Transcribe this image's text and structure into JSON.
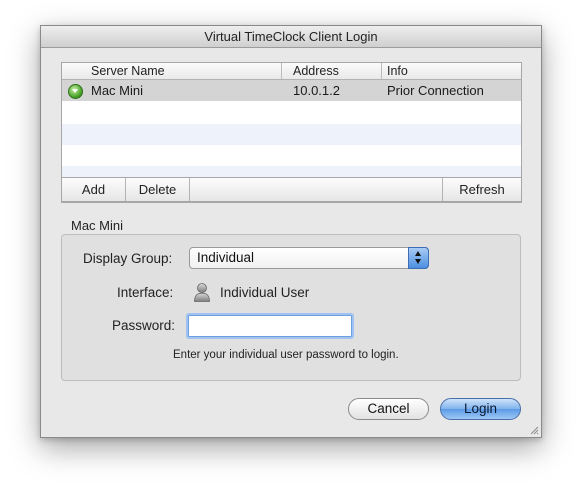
{
  "window": {
    "title": "Virtual TimeClock Client Login"
  },
  "server_table": {
    "columns": [
      "Server Name",
      "Address",
      "Info"
    ],
    "rows": [
      {
        "name": "Mac Mini",
        "address": "10.0.1.2",
        "info": "Prior Connection",
        "icon": "green-disclosure-icon"
      }
    ]
  },
  "toolbar": {
    "add_label": "Add",
    "delete_label": "Delete",
    "refresh_label": "Refresh"
  },
  "server_detail": {
    "section_title": "Mac Mini",
    "display_group_label": "Display Group:",
    "display_group_value": "Individual",
    "interface_label": "Interface:",
    "interface_value": "Individual User",
    "interface_icon": "user-icon",
    "password_label": "Password:",
    "password_value": "",
    "hint": "Enter your individual user password to login."
  },
  "buttons": {
    "cancel_label": "Cancel",
    "login_label": "Login"
  },
  "colors": {
    "selection": "#d4d4d4",
    "stripe": "#eef3fb",
    "accent": "#5c9ae6"
  }
}
